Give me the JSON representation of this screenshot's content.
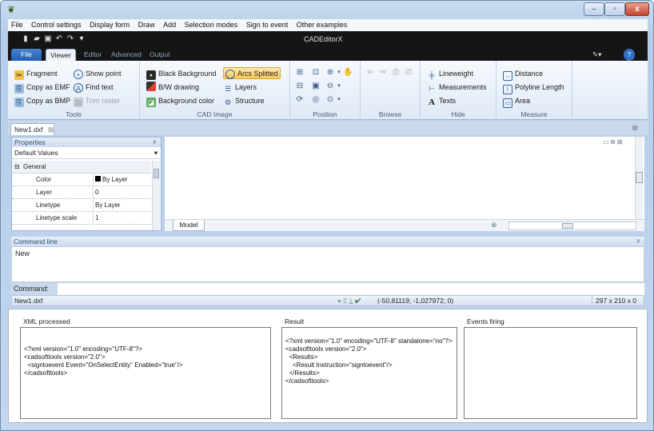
{
  "app": {
    "doc_title": "CADEditorX",
    "close_glyph": "x",
    "min_glyph": "–",
    "max_glyph": "▫"
  },
  "menu": [
    "File",
    "Control settings",
    "Display form",
    "Draw",
    "Add",
    "Selection modes",
    "Sign to event",
    "Other examples"
  ],
  "ribbon_tabs": [
    "File",
    "Viewer",
    "Editor",
    "Advanced",
    "Output"
  ],
  "groups": {
    "tools": {
      "label": "Tools",
      "items": [
        "Fragment",
        "Show point",
        "Copy as EMF",
        "Find text",
        "Copy as BMP",
        "Trim raster"
      ]
    },
    "cad_image": {
      "label": "CAD Image",
      "items": [
        "Black Background",
        "Arcs Splitted",
        "B/W drawing",
        "Layers",
        "Background color",
        "Structure"
      ]
    },
    "position": {
      "label": "Position"
    },
    "browse": {
      "label": "Browse"
    },
    "hide": {
      "label": "Hide",
      "items": [
        "Lineweight",
        "Measurements",
        "Texts"
      ]
    },
    "measure": {
      "label": "Measure",
      "items": [
        "Distance",
        "Polyline Length",
        "Area"
      ]
    }
  },
  "doc_tab": "New1.dxf",
  "properties": {
    "header": "Properties",
    "dropdown": "Default Values",
    "group": "General",
    "rows": [
      {
        "k": "Color",
        "v": "By Layer"
      },
      {
        "k": "Layer",
        "v": "0"
      },
      {
        "k": "Linetype",
        "v": "By Layer"
      },
      {
        "k": "Linetype scale",
        "v": "1"
      }
    ]
  },
  "model_tab": "Model",
  "command": {
    "header": "Command line",
    "output": "New",
    "label": "Command:"
  },
  "status": {
    "file": "New1.dxf",
    "coords": "(-50,81119; -1,027972; 0)",
    "size": "297 x 210 x 0"
  },
  "bottom": {
    "xml_label": "XML processed",
    "xml": "<?xml version=\"1.0\" encoding=\"UTF-8\"?>\n<cadsofttools version=\"2.0\">\n  <signtoevent Event=\"OnSelectEntity\" Enabled=\"true\"/>\n</cadsofttools>",
    "result_label": "Result",
    "result": "<?xml version=\"1.0\" encoding=\"UTF-8\" standalone=\"no\"?>\n<cadsofttools version=\"2.0\">\n  <Results>\n    <Result Instruction=\"signtoevent\"/>\n  </Results>\n</cadsofttools>",
    "events_label": "Events firing"
  }
}
